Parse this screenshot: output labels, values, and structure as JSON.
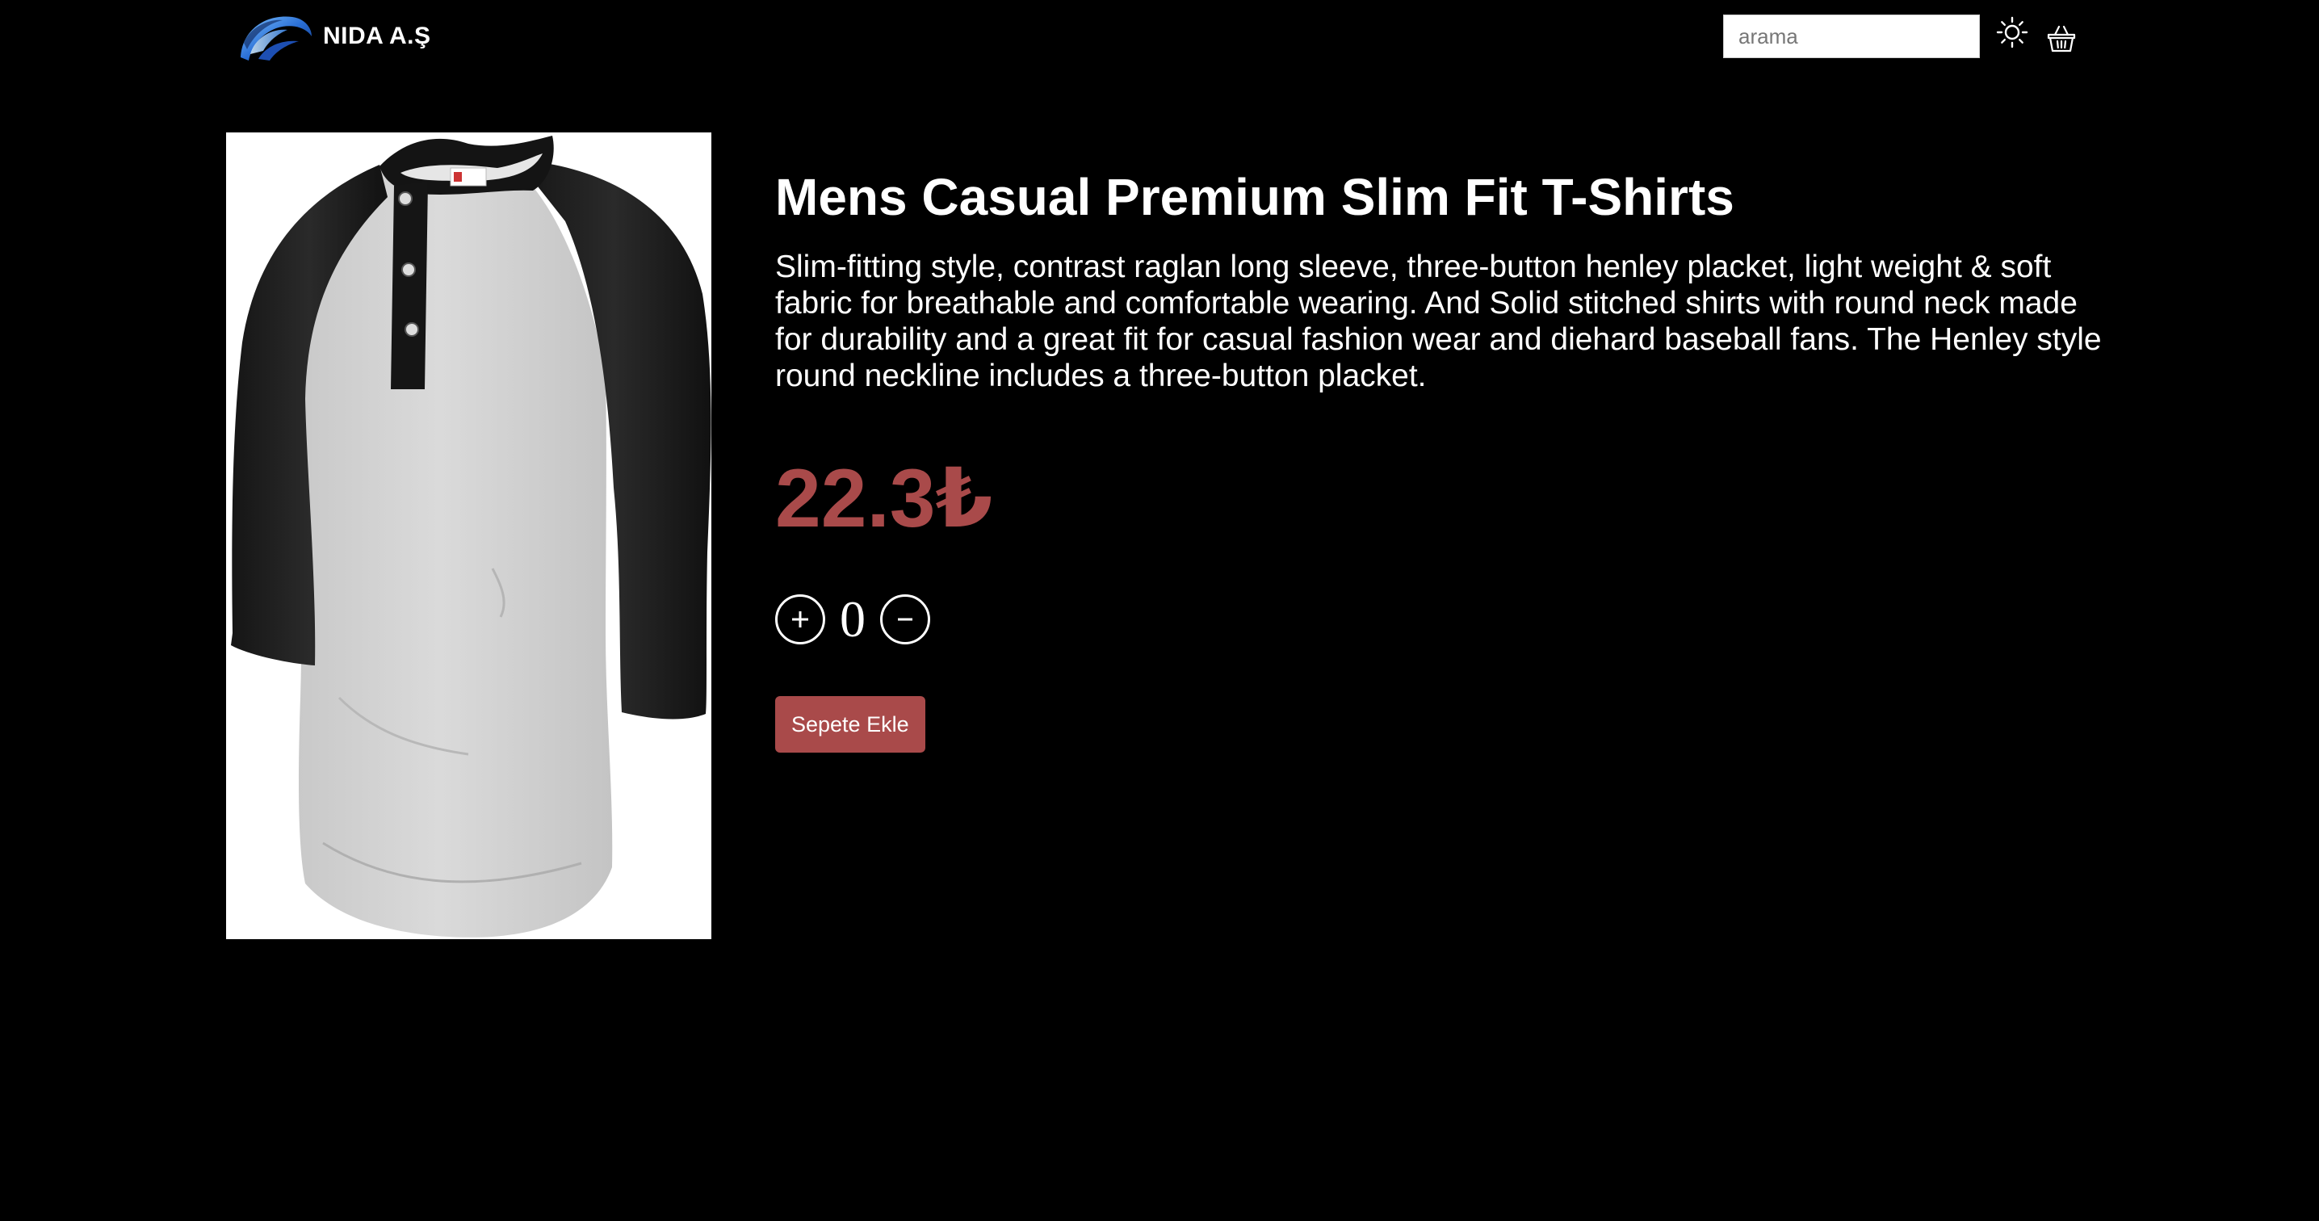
{
  "header": {
    "brand_name": "NIDA A.Ş",
    "search": {
      "placeholder": "arama",
      "value": ""
    },
    "icons": {
      "logo": "globe-swoosh-logo",
      "theme": "sun-icon",
      "cart": "shopping-basket-icon"
    }
  },
  "product": {
    "image_icon": "raglan-henley-shirt-image",
    "title": "Mens Casual Premium Slim Fit T-Shirts",
    "description": "Slim-fitting style, contrast raglan long sleeve, three-button henley placket, light weight & soft fabric for breathable and comfortable wearing. And Solid stitched shirts with round neck made for durability and a great fit for casual fashion wear and diehard baseball fans. The Henley style round neckline includes a three-button placket.",
    "price": "22.3₺",
    "quantity": "0",
    "add_to_cart_label": "Sepete Ekle"
  },
  "colors": {
    "background": "#000000",
    "accent": "#a94a4a",
    "text": "#ffffff"
  }
}
